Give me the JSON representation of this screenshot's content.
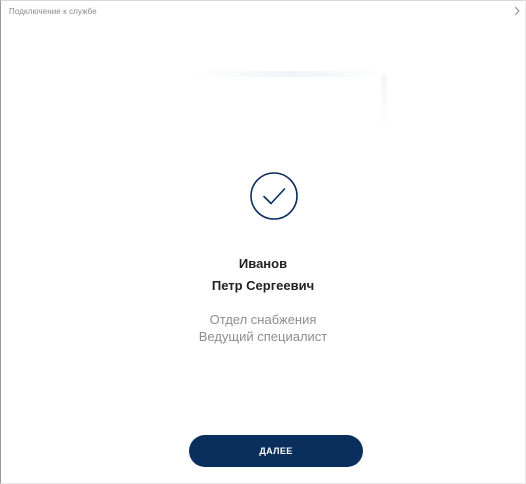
{
  "window": {
    "title": "Подключение к службе",
    "close_icon": "chevron-right-icon"
  },
  "status": {
    "icon": "checkmark-circle-icon",
    "color": "#0b2f5c"
  },
  "user": {
    "surname": "Иванов",
    "given_names": "Петр Сергеевич",
    "department": "Отдел снабжения",
    "position": "Ведущий специалист"
  },
  "actions": {
    "next_label": "ДАЛЕЕ",
    "button_color": "#0b2f5c"
  }
}
